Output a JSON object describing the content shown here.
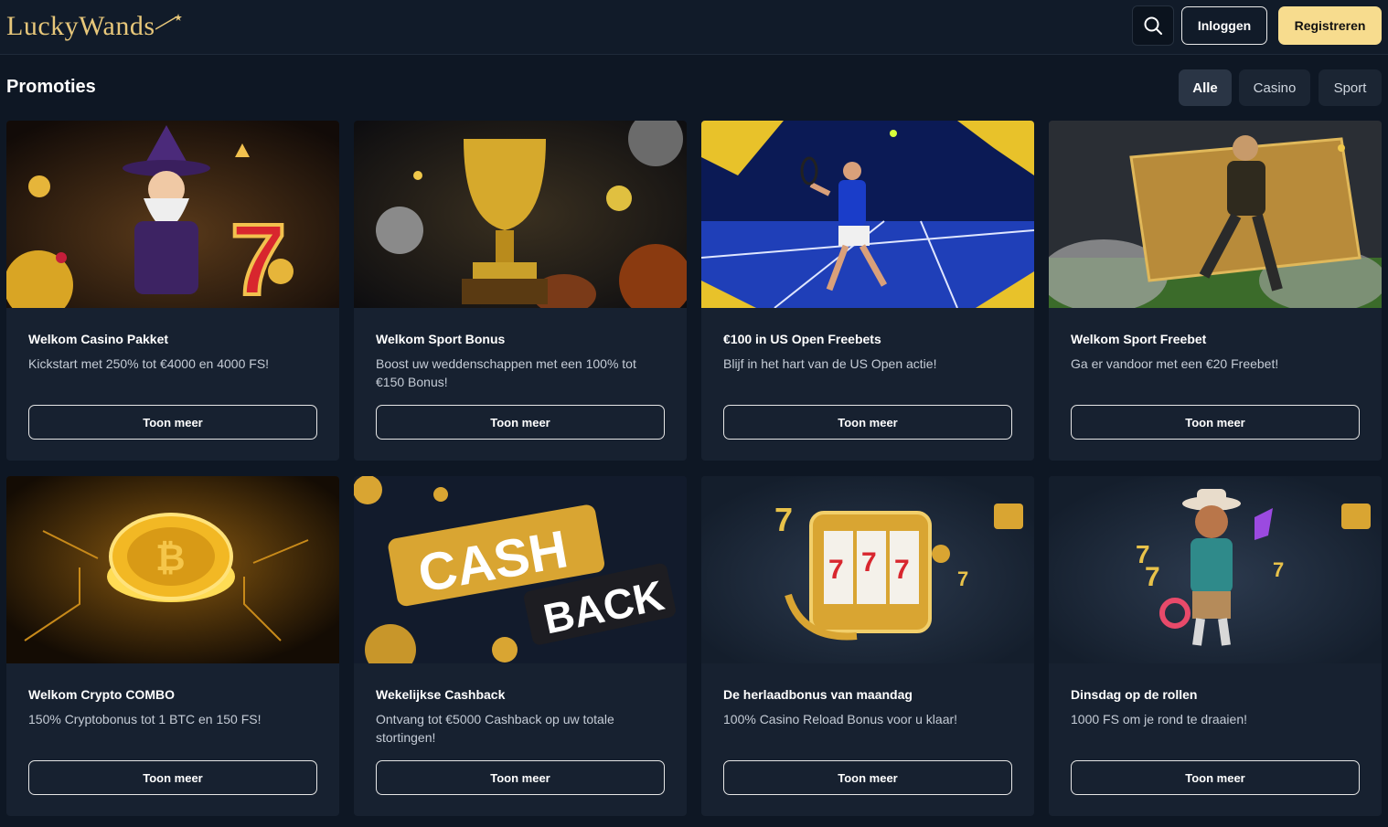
{
  "header": {
    "logo_text": "LuckyWands",
    "login_label": "Inloggen",
    "register_label": "Registreren"
  },
  "page": {
    "title": "Promoties"
  },
  "filters": [
    {
      "label": "Alle",
      "active": true
    },
    {
      "label": "Casino",
      "active": false
    },
    {
      "label": "Sport",
      "active": false
    }
  ],
  "promotions": [
    {
      "title": "Welkom Casino Pakket",
      "description": "Kickstart met 250% tot €4000 en 4000 FS!",
      "button": "Toon meer",
      "image": "wizard-slot-illustration"
    },
    {
      "title": "Welkom Sport Bonus",
      "description": "Boost uw weddenschappen met een 100% tot €150 Bonus!",
      "button": "Toon meer",
      "image": "golden-trophy-illustration"
    },
    {
      "title": "€100 in US Open Freebets",
      "description": "Blijf in het hart van de US Open actie!",
      "button": "Toon meer",
      "image": "tennis-player-illustration"
    },
    {
      "title": "Welkom Sport Freebet",
      "description": "Ga er vandoor met een €20 Freebet!",
      "button": "Toon meer",
      "image": "football-player-ticket-illustration"
    },
    {
      "title": "Welkom Crypto COMBO",
      "description": "150% Cryptobonus tot 1 BTC en 150 FS!",
      "button": "Toon meer",
      "image": "bitcoin-coin-illustration"
    },
    {
      "title": "Wekelijkse Cashback",
      "description": "Ontvang tot €5000 Cashback op uw totale stortingen!",
      "button": "Toon meer",
      "image": "cashback-illustration"
    },
    {
      "title": "De herlaadbonus van maandag",
      "description": "100% Casino Reload Bonus voor u klaar!",
      "button": "Toon meer",
      "image": "slot-machine-illustration"
    },
    {
      "title": "Dinsdag op de rollen",
      "description": "1000 FS om je rond te draaien!",
      "button": "Toon meer",
      "image": "cowboy-character-illustration"
    }
  ],
  "colors": {
    "background": "#0e1724",
    "card": "#172130",
    "accent": "#f7dc8e",
    "logo_gold": "#e7c77a"
  }
}
